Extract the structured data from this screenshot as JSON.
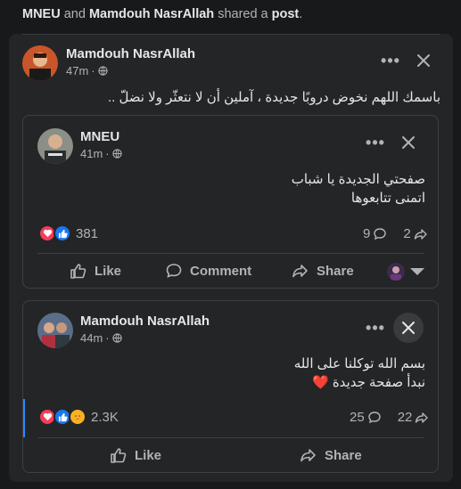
{
  "notification": {
    "actor1": "MNEU",
    "and_text": "and",
    "actor2": "Mamdouh NasrAllah",
    "shared_text": "shared a",
    "post_text": "post",
    "end": "."
  },
  "main_post": {
    "author": "Mamdouh NasrAllah",
    "time": "47m",
    "dot": "·",
    "text": "باسمك اللهم نخوض دروبًا جديدة ، آملين أن لا نتعثّر ولا نضلّ .."
  },
  "shared_post": {
    "author": "MNEU",
    "time": "41m",
    "dot": "·",
    "line1": "صفحتي الجديدة يا شباب",
    "line2": "اتمنى تتابعوها",
    "reactions_count": "381",
    "comments_count": "9",
    "shares_count": "2",
    "actions": {
      "like": "Like",
      "comment": "Comment",
      "share": "Share"
    }
  },
  "second_post": {
    "author": "Mamdouh NasrAllah",
    "time": "44m",
    "dot": "·",
    "line1": "بسم الله توكلنا على الله",
    "line2": "نبدأ صفحة جديدة ❤️",
    "reactions_count": "2.3K",
    "comments_count": "25",
    "shares_count": "22",
    "actions": {
      "like": "Like",
      "share": "Share"
    }
  },
  "colors": {
    "background": "#18191a",
    "card": "#242526",
    "like_blue": "#1877f2",
    "love_red": "#f33e58",
    "care_yellow": "#f7b125",
    "accent_bar": "#2d88ff"
  }
}
